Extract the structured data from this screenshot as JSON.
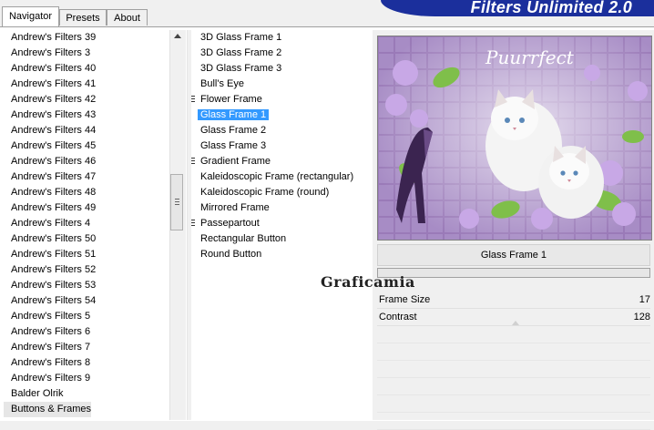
{
  "tabs": [
    {
      "label": "Navigator",
      "active": true
    },
    {
      "label": "Presets",
      "active": false
    },
    {
      "label": "About",
      "active": false
    }
  ],
  "app_title": "Filters Unlimited 2.0",
  "categories": [
    "Andrew's Filters 39",
    "Andrew's Filters 3",
    "Andrew's Filters 40",
    "Andrew's Filters 41",
    "Andrew's Filters 42",
    "Andrew's Filters 43",
    "Andrew's Filters 44",
    "Andrew's Filters 45",
    "Andrew's Filters 46",
    "Andrew's Filters 47",
    "Andrew's Filters 48",
    "Andrew's Filters 49",
    "Andrew's Filters 4",
    "Andrew's Filters 50",
    "Andrew's Filters 51",
    "Andrew's Filters 52",
    "Andrew's Filters 53",
    "Andrew's Filters 54",
    "Andrew's Filters 5",
    "Andrew's Filters 6",
    "Andrew's Filters 7",
    "Andrew's Filters 8",
    "Andrew's Filters 9",
    "Balder Olrik",
    "Buttons & Frames"
  ],
  "filters": [
    {
      "label": "3D Glass Frame 1",
      "marker": false
    },
    {
      "label": "3D Glass Frame 2",
      "marker": false
    },
    {
      "label": "3D Glass Frame 3",
      "marker": false
    },
    {
      "label": "Bull's Eye",
      "marker": false
    },
    {
      "label": "Flower Frame",
      "marker": true
    },
    {
      "label": "Glass Frame 1",
      "marker": false,
      "selected": true
    },
    {
      "label": "Glass Frame 2",
      "marker": false
    },
    {
      "label": "Glass Frame 3",
      "marker": false
    },
    {
      "label": "Gradient Frame",
      "marker": true
    },
    {
      "label": "Kaleidoscopic Frame (rectangular)",
      "marker": false
    },
    {
      "label": "Kaleidoscopic Frame (round)",
      "marker": false
    },
    {
      "label": "Mirrored Frame",
      "marker": false
    },
    {
      "label": "Passepartout",
      "marker": true
    },
    {
      "label": "Rectangular Button",
      "marker": false
    },
    {
      "label": "Round Button",
      "marker": false
    }
  ],
  "preview": {
    "caption": "Puurrfect"
  },
  "current_filter": "Glass Frame 1",
  "watermark": "Graficamia",
  "params": [
    {
      "label": "Frame Size",
      "value": "17"
    },
    {
      "label": "Contrast",
      "value": "128"
    }
  ],
  "colors": {
    "accent": "#1b2f9c",
    "selection": "#3399ff",
    "preview_purple": "#8a6aa8"
  }
}
